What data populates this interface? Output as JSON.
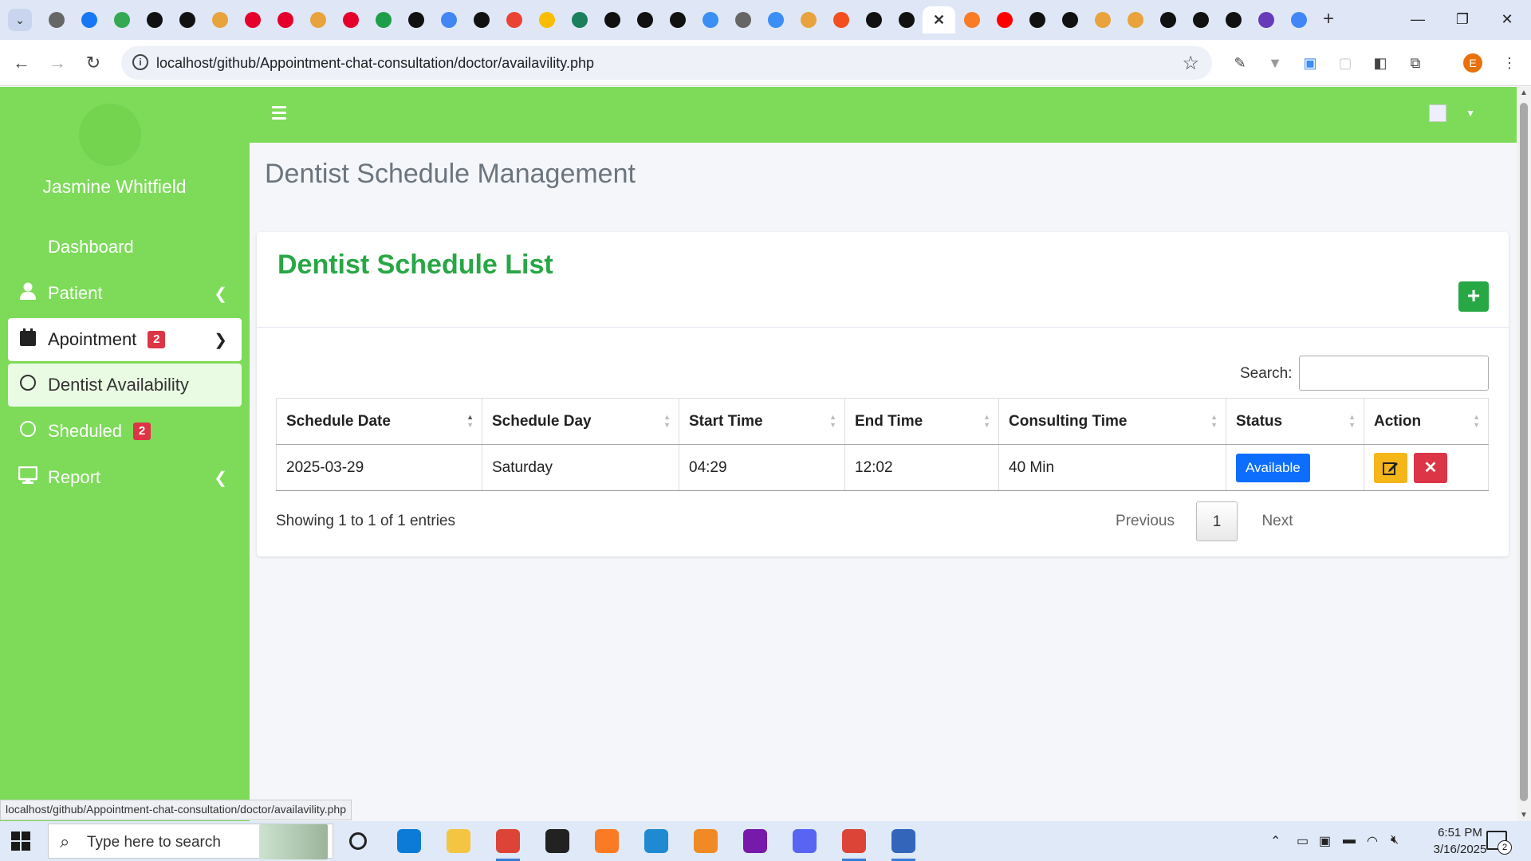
{
  "browser": {
    "url": "localhost/github/Appointment-chat-consultation/doctor/availavility.php",
    "status_url": "localhost/github/Appointment-chat-consultation/doctor/availavility.php",
    "tabs": [
      {
        "icon": "world-icon",
        "color": "#666"
      },
      {
        "icon": "facebook-icon",
        "color": "#1877f2"
      },
      {
        "icon": "meet-icon",
        "color": "#34a853"
      },
      {
        "icon": "openai-icon",
        "color": "#111"
      },
      {
        "icon": "openai-icon",
        "color": "#111"
      },
      {
        "icon": "pma-icon",
        "color": "#e8a33d"
      },
      {
        "icon": "huawei-icon",
        "color": "#e4002b"
      },
      {
        "icon": "huawei-icon",
        "color": "#e4002b"
      },
      {
        "icon": "pma-icon",
        "color": "#e8a33d"
      },
      {
        "icon": "huawei-icon",
        "color": "#e4002b"
      },
      {
        "icon": "aa-icon",
        "color": "#1e9e4a"
      },
      {
        "icon": "openai-icon",
        "color": "#111"
      },
      {
        "icon": "docs-icon",
        "color": "#4285f4"
      },
      {
        "icon": "openai-icon",
        "color": "#111"
      },
      {
        "icon": "gmail-icon",
        "color": "#ea4335"
      },
      {
        "icon": "drive-icon",
        "color": "#fbbc04"
      },
      {
        "icon": "search-app-icon",
        "color": "#1a7f5a"
      },
      {
        "icon": "chatgpt-icon",
        "color": "#111"
      },
      {
        "icon": "chatgpt-icon",
        "color": "#111"
      },
      {
        "icon": "chatgpt-icon",
        "color": "#111"
      },
      {
        "icon": "copilot-icon",
        "color": "#3b8ef3"
      },
      {
        "icon": "world-icon",
        "color": "#666"
      },
      {
        "icon": "copilot-icon",
        "color": "#3b8ef3"
      },
      {
        "icon": "pma-icon",
        "color": "#e8a33d"
      },
      {
        "icon": "figma-icon",
        "color": "#f24e1e"
      },
      {
        "icon": "github-icon",
        "color": "#111"
      },
      {
        "icon": "openai-icon",
        "color": "#111"
      },
      {
        "icon": "close-icon",
        "color": "#333",
        "active": true
      },
      {
        "icon": "xampp-icon",
        "color": "#fb7a24"
      },
      {
        "icon": "youtube-icon",
        "color": "#ff0000"
      },
      {
        "icon": "github-icon",
        "color": "#111"
      },
      {
        "icon": "openai-icon",
        "color": "#111"
      },
      {
        "icon": "pma-icon",
        "color": "#e8a33d"
      },
      {
        "icon": "pma-icon",
        "color": "#e8a33d"
      },
      {
        "icon": "openai-icon",
        "color": "#111"
      },
      {
        "icon": "openai-icon",
        "color": "#111"
      },
      {
        "icon": "github-icon",
        "color": "#111"
      },
      {
        "icon": "forms-icon",
        "color": "#673ab7"
      },
      {
        "icon": "google-icon",
        "color": "#4285f4"
      }
    ],
    "profile_initial": "E"
  },
  "sidebar": {
    "user_name": "Jasmine Whitfield",
    "items": [
      {
        "label": "Dashboard"
      },
      {
        "label": "Patient"
      },
      {
        "label": "Apointment",
        "badge": "2"
      },
      {
        "label": "Dentist Availability"
      },
      {
        "label": "Sheduled",
        "badge": "2"
      },
      {
        "label": "Report"
      }
    ]
  },
  "main": {
    "page_title": "Dentist Schedule Management",
    "card_title": "Dentist Schedule List",
    "add_label": "+",
    "search_label": "Search:",
    "search_value": "",
    "columns": [
      "Schedule Date",
      "Schedule Day",
      "Start Time",
      "End Time",
      "Consulting Time",
      "Status",
      "Action"
    ],
    "rows": [
      {
        "date": "2025-03-29",
        "day": "Saturday",
        "start": "04:29",
        "end": "12:02",
        "consult": "40 Min",
        "status": "Available"
      }
    ],
    "info": "Showing 1 to 1 of 1 entries",
    "pager": {
      "previous": "Previous",
      "current": "1",
      "next": "Next"
    }
  },
  "taskbar": {
    "search_placeholder": "Type here to search",
    "time": "6:51 PM",
    "date": "3/16/2025",
    "notifications": "2",
    "apps": [
      {
        "name": "edge",
        "color": "#0c7bd8"
      },
      {
        "name": "explorer",
        "color": "#f4c542"
      },
      {
        "name": "chrome",
        "color": "#db4437"
      },
      {
        "name": "sticky",
        "color": "#222"
      },
      {
        "name": "xampp",
        "color": "#fb7a24"
      },
      {
        "name": "vscode",
        "color": "#1f8ad2"
      },
      {
        "name": "sublime",
        "color": "#f08a24"
      },
      {
        "name": "onenote",
        "color": "#7719aa"
      },
      {
        "name": "discord",
        "color": "#5865f2"
      },
      {
        "name": "chrome-profile",
        "color": "#db4437"
      },
      {
        "name": "snip",
        "color": "#36b"
      }
    ]
  }
}
